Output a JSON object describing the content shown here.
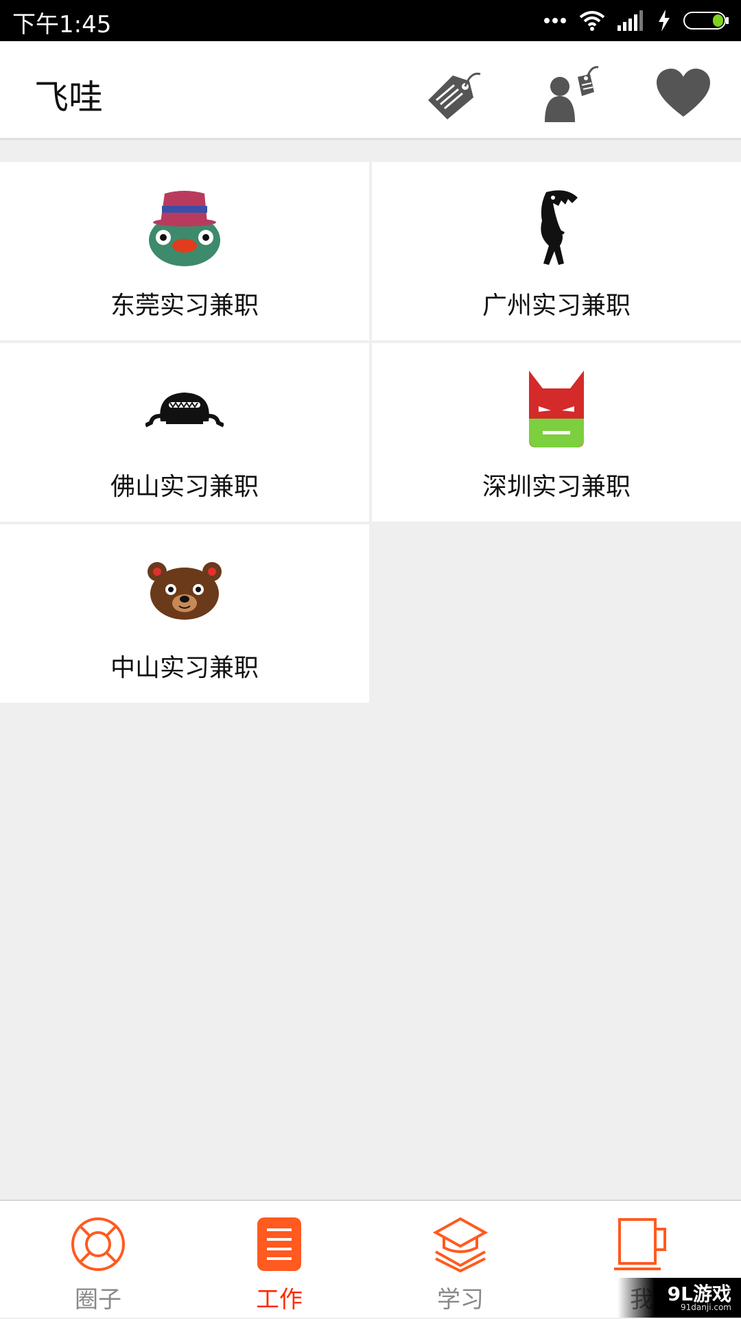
{
  "status_bar": {
    "time": "下午1:45",
    "icons": [
      "more-dots-icon",
      "wifi-icon",
      "signal-icon",
      "charging-icon",
      "battery-icon"
    ]
  },
  "header": {
    "title": "飞哇",
    "actions": [
      "tag-icon",
      "user-tag-icon",
      "heart-icon"
    ]
  },
  "grid": {
    "items": [
      {
        "label": "东莞实习兼职",
        "icon": "duck-hat-mascot-icon"
      },
      {
        "label": "广州实习兼职",
        "icon": "dino-monster-mascot-icon"
      },
      {
        "label": "佛山实习兼职",
        "icon": "black-blob-mascot-icon"
      },
      {
        "label": "深圳实习兼职",
        "icon": "bat-mask-mascot-icon"
      },
      {
        "label": "中山实习兼职",
        "icon": "bear-mascot-icon"
      }
    ]
  },
  "bottom_nav": {
    "active_index": 1,
    "items": [
      {
        "label": "圈子",
        "icon": "lifebuoy-icon"
      },
      {
        "label": "工作",
        "icon": "list-icon"
      },
      {
        "label": "学习",
        "icon": "graduation-cap-icon"
      },
      {
        "label": "我",
        "icon": "cup-icon"
      }
    ]
  },
  "watermark": {
    "main": "9L游戏",
    "sub": "91danji.com"
  },
  "colors": {
    "accent": "#ff5a1f",
    "active_label": "#ff2a00",
    "icon_gray": "#555555",
    "background": "#efefef"
  }
}
